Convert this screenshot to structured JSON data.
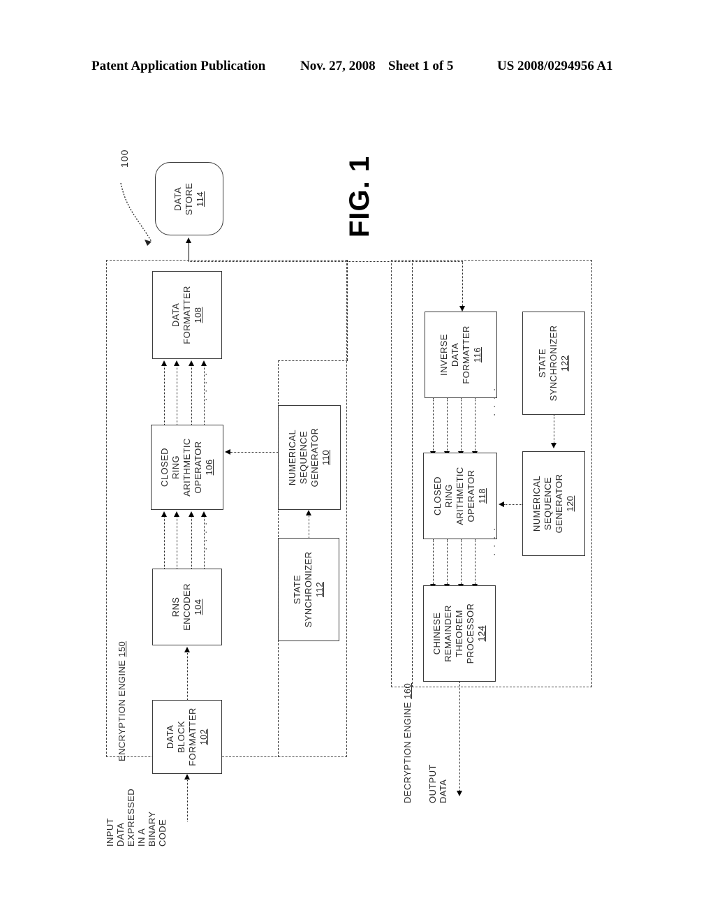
{
  "header": {
    "publication": "Patent Application Publication",
    "date": "Nov. 27, 2008",
    "sheet": "Sheet 1 of 5",
    "patent_number": "US 2008/0294956 A1"
  },
  "figure": {
    "caption": "FIG. 1",
    "system_reference": "100"
  },
  "blocks": {
    "data_store": {
      "title": "DATA STORE",
      "lines": [
        "DATA",
        "STORE"
      ],
      "num": "114"
    },
    "data_formatter": {
      "title": "DATA FORMATTER",
      "lines": [
        "DATA",
        "FORMATTER"
      ],
      "num": "108"
    },
    "closed_ring_enc": {
      "title": "CLOSED RING ARITHMETIC OPERATOR",
      "lines": [
        "CLOSED",
        "RING",
        "ARITHMETIC",
        "OPERATOR"
      ],
      "num": "106"
    },
    "rns_encoder": {
      "title": "RNS ENCODER",
      "lines": [
        "RNS",
        "ENCODER"
      ],
      "num": "104"
    },
    "data_block_fmt": {
      "title": "DATA BLOCK FORMATTER",
      "lines": [
        "DATA",
        "BLOCK",
        "FORMATTER"
      ],
      "num": "102"
    },
    "num_seq_gen_enc": {
      "title": "NUMERICAL SEQUENCE GENERATOR",
      "lines": [
        "NUMERICAL",
        "SEQUENCE",
        "GENERATOR"
      ],
      "num": "110"
    },
    "state_sync_enc": {
      "title": "STATE SYNCHRONIZER",
      "lines": [
        "STATE",
        "SYNCHRONIZER"
      ],
      "num": "112"
    },
    "inverse_data_fmt": {
      "title": "INVERSE DATA FORMATTER",
      "lines": [
        "INVERSE",
        "DATA",
        "FORMATTER"
      ],
      "num": "116"
    },
    "closed_ring_dec": {
      "title": "CLOSED RING ARITHMETIC OPERATOR",
      "lines": [
        "CLOSED",
        "RING",
        "ARITHMETIC",
        "OPERATOR"
      ],
      "num": "118"
    },
    "crt_processor": {
      "title": "CHINESE REMAINDER THEOREM PROCESSOR",
      "lines": [
        "CHINESE",
        "REMAINDER",
        "THEOREM",
        "PROCESSOR"
      ],
      "num": "124"
    },
    "num_seq_gen_dec": {
      "title": "NUMERICAL SEQUENCE GENERATOR",
      "lines": [
        "NUMERICAL",
        "SEQUENCE",
        "GENERATOR"
      ],
      "num": "120"
    },
    "state_sync_dec": {
      "title": "STATE SYNCHRONIZER",
      "lines": [
        "STATE",
        "SYNCHRONIZER"
      ],
      "num": "122"
    }
  },
  "engines": {
    "encryption": {
      "label": "ENCRYPTION ENGINE",
      "num": "150"
    },
    "decryption": {
      "label": "DECRYPTION ENGINE",
      "num": "160"
    }
  },
  "signals": {
    "input_data": "INPUT DATA EXPRESSED IN A BINARY CODE",
    "input_data_lines": [
      "INPUT",
      "DATA",
      "EXPRESSED",
      "IN A",
      "BINARY",
      "CODE"
    ],
    "output_data": "OUTPUT DATA",
    "output_data_lines": [
      "OUTPUT",
      "DATA"
    ],
    "bus_ellipsis": "· · · ·"
  },
  "colors": {
    "ink": "#000000",
    "box_stroke": "#3a3a3a",
    "boundary_stroke": "#4a4a4a",
    "background": "#ffffff"
  }
}
